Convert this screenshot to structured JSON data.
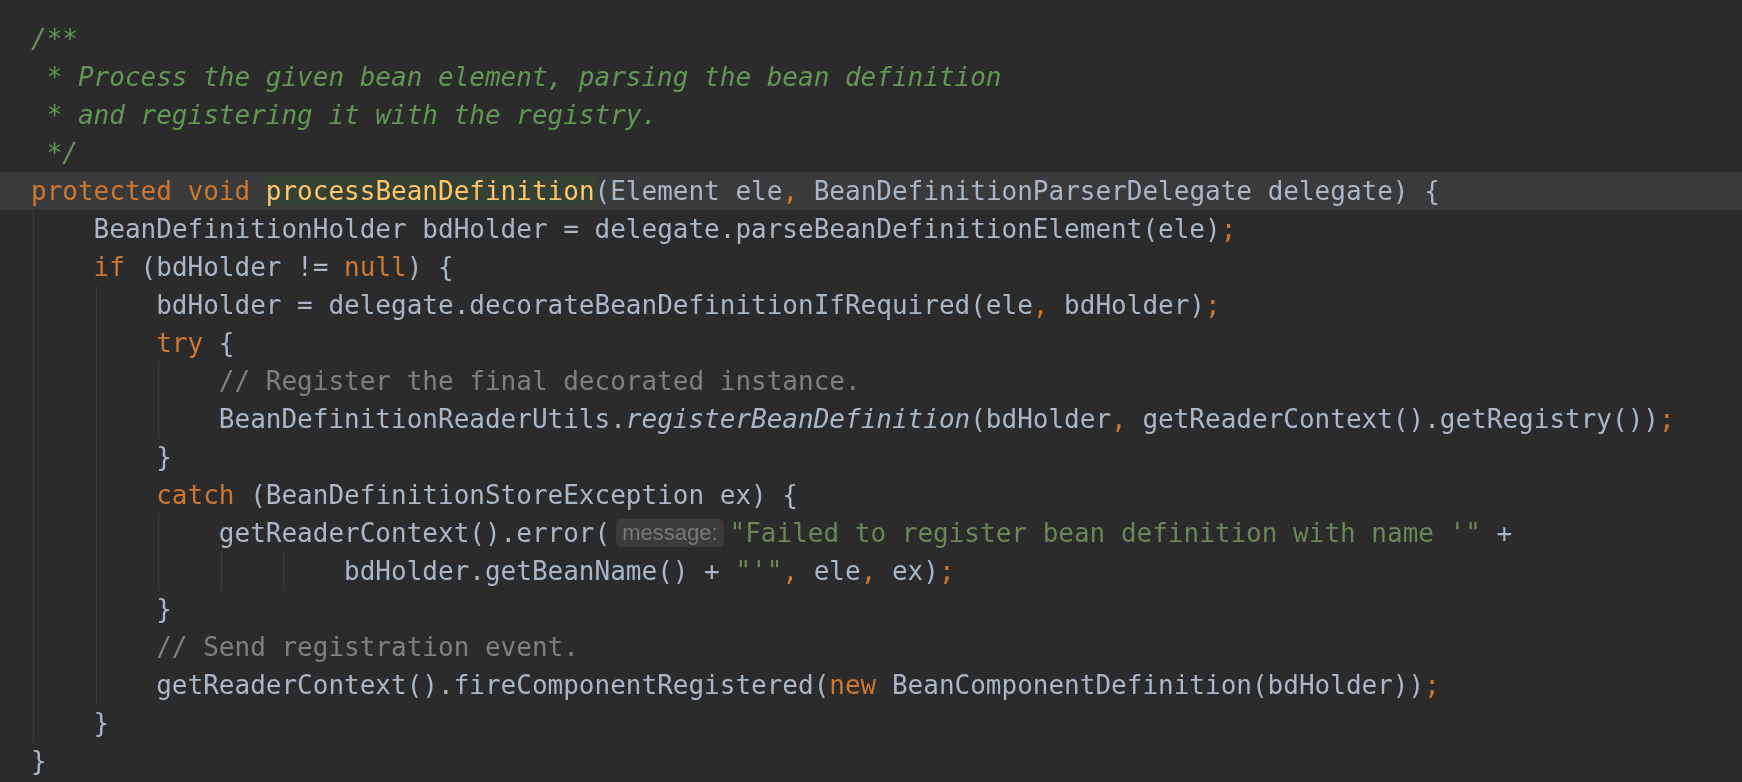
{
  "editor": {
    "lines": [
      {
        "current": false,
        "tokens": [
          {
            "kind": "doc",
            "text": "/**"
          }
        ]
      },
      {
        "current": false,
        "tokens": [
          {
            "kind": "doc",
            "text": " * Process the given bean element, parsing the bean definition"
          }
        ]
      },
      {
        "current": false,
        "tokens": [
          {
            "kind": "doc",
            "text": " * and registering it with the registry."
          }
        ]
      },
      {
        "current": false,
        "tokens": [
          {
            "kind": "doc",
            "text": " */"
          }
        ]
      },
      {
        "current": true,
        "tokens": [
          {
            "kind": "keyword",
            "text": "protected void "
          },
          {
            "kind": "declaration",
            "text": "processBeanDefinition"
          },
          {
            "kind": "plain",
            "text": "(Element ele"
          },
          {
            "kind": "punct",
            "text": ","
          },
          {
            "kind": "plain",
            "text": " BeanDefinitionParserDelegate delegate) {"
          }
        ]
      },
      {
        "current": false,
        "tokens": [
          {
            "kind": "plain",
            "text": "    BeanDefinitionHolder bdHolder = delegate.parseBeanDefinitionElement(ele)"
          },
          {
            "kind": "punct",
            "text": ";"
          }
        ]
      },
      {
        "current": false,
        "tokens": [
          {
            "kind": "keyword",
            "text": "    if"
          },
          {
            "kind": "plain",
            "text": " (bdHolder != "
          },
          {
            "kind": "keyword",
            "text": "null"
          },
          {
            "kind": "plain",
            "text": ") {"
          }
        ]
      },
      {
        "current": false,
        "tokens": [
          {
            "kind": "plain",
            "text": "        bdHolder = delegate.decorateBeanDefinitionIfRequired(ele"
          },
          {
            "kind": "punct",
            "text": ","
          },
          {
            "kind": "plain",
            "text": " bdHolder)"
          },
          {
            "kind": "punct",
            "text": ";"
          }
        ]
      },
      {
        "current": false,
        "tokens": [
          {
            "kind": "keyword",
            "text": "        try"
          },
          {
            "kind": "plain",
            "text": " {"
          }
        ]
      },
      {
        "current": false,
        "tokens": [
          {
            "kind": "comment",
            "text": "            // Register the final decorated instance."
          }
        ]
      },
      {
        "current": false,
        "tokens": [
          {
            "kind": "plain",
            "text": "            BeanDefinitionReaderUtils."
          },
          {
            "kind": "static",
            "text": "registerBeanDefinition"
          },
          {
            "kind": "plain",
            "text": "(bdHolder"
          },
          {
            "kind": "punct",
            "text": ","
          },
          {
            "kind": "plain",
            "text": " getReaderContext().getRegistry())"
          },
          {
            "kind": "punct",
            "text": ";"
          }
        ]
      },
      {
        "current": false,
        "tokens": [
          {
            "kind": "plain",
            "text": "        }"
          }
        ]
      },
      {
        "current": false,
        "tokens": [
          {
            "kind": "keyword",
            "text": "        catch"
          },
          {
            "kind": "plain",
            "text": " (BeanDefinitionStoreException ex) {"
          }
        ]
      },
      {
        "current": false,
        "tokens": [
          {
            "kind": "plain",
            "text": "            getReaderContext().error("
          },
          {
            "kind": "hint",
            "text": "message:"
          },
          {
            "kind": "string",
            "text": "\"Failed to register bean definition with name '\""
          },
          {
            "kind": "plain",
            "text": " +"
          }
        ]
      },
      {
        "current": false,
        "tokens": [
          {
            "kind": "plain",
            "text": "                    bdHolder.getBeanName() + "
          },
          {
            "kind": "string",
            "text": "\"'\""
          },
          {
            "kind": "punct",
            "text": ","
          },
          {
            "kind": "plain",
            "text": " ele"
          },
          {
            "kind": "punct",
            "text": ","
          },
          {
            "kind": "plain",
            "text": " ex)"
          },
          {
            "kind": "punct",
            "text": ";"
          }
        ]
      },
      {
        "current": false,
        "tokens": [
          {
            "kind": "plain",
            "text": "        }"
          }
        ]
      },
      {
        "current": false,
        "tokens": [
          {
            "kind": "comment",
            "text": "        // Send registration event."
          }
        ]
      },
      {
        "current": false,
        "tokens": [
          {
            "kind": "plain",
            "text": "        getReaderContext().fireComponentRegistered("
          },
          {
            "kind": "keyword",
            "text": "new"
          },
          {
            "kind": "plain",
            "text": " BeanComponentDefinition(bdHolder))"
          },
          {
            "kind": "punct",
            "text": ";"
          }
        ]
      },
      {
        "current": false,
        "tokens": [
          {
            "kind": "plain",
            "text": "    }"
          }
        ]
      },
      {
        "current": false,
        "tokens": [
          {
            "kind": "plain",
            "text": "}"
          }
        ]
      }
    ]
  }
}
